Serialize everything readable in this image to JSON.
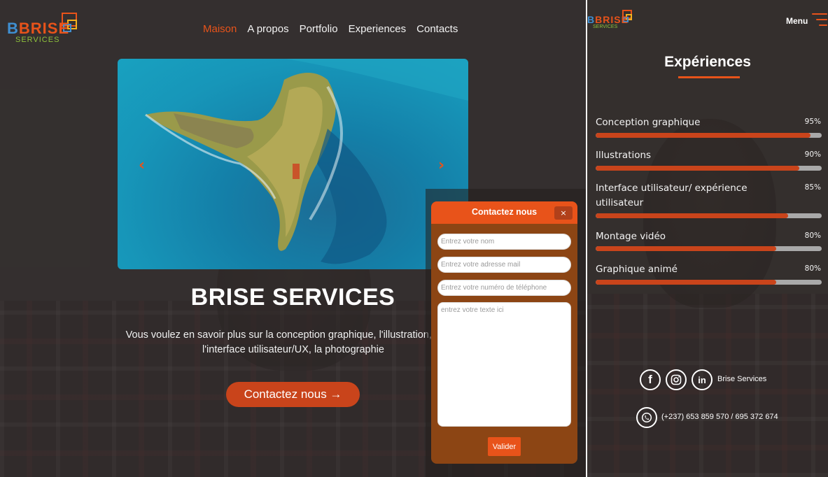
{
  "brand": {
    "logo_word": "BRISE",
    "logo_sub": "SERVICES",
    "colors": {
      "accent": "#e8531a",
      "logo_green": "#8fc23c",
      "logo_blue": "#3f8fd2"
    }
  },
  "nav": {
    "items": [
      "Maison",
      "A propos",
      "Portfolio",
      "Experiences",
      "Contacts"
    ],
    "active": "Maison"
  },
  "carousel": {
    "prev_icon": "chevron-left-icon",
    "next_icon": "chevron-right-icon"
  },
  "hero": {
    "title": "BRISE SERVICES",
    "text_line1": "Vous voulez en savoir plus sur la conception graphique, l'illustration, l'anim",
    "text_line2": "l'interface utilisateur/UX, la photographie",
    "button": "Contactez nous →"
  },
  "modal": {
    "title": "Contactez nous",
    "close": "×",
    "name_placeholder": "Entrez votre nom",
    "email_placeholder": "Entrez votre adresse mail",
    "phone_placeholder": "Entrez votre numéro de téléphone",
    "message_placeholder": "entrez votre texte ici",
    "submit": "Valider"
  },
  "mobile": {
    "menu_label": "Menu",
    "section_title": "Expériences",
    "skills": [
      {
        "label": "Conception graphique",
        "percent": "95%",
        "level": 0.95
      },
      {
        "label": "Illustrations",
        "percent": "90%",
        "level": 0.9
      },
      {
        "label": "Interface utilisateur/ expérience utilisateur",
        "percent": "85%",
        "level": 0.85
      },
      {
        "label": "Montage vidéo",
        "percent": "80%",
        "level": 0.8
      },
      {
        "label": "Graphique animé",
        "percent": "80%",
        "level": 0.8
      }
    ],
    "footer": {
      "social_name": "Brise Services",
      "phone": "(+237) 653 859 570 / 695 372 674",
      "icons": [
        "facebook-icon",
        "instagram-icon",
        "linkedin-icon",
        "whatsapp-icon"
      ]
    }
  }
}
